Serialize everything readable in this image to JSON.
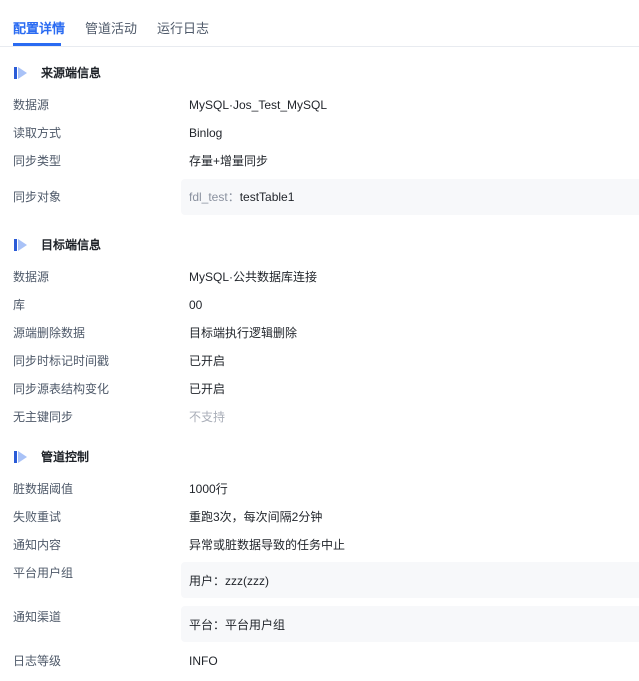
{
  "tabs": [
    {
      "label": "配置详情"
    },
    {
      "label": "管道活动"
    },
    {
      "label": "运行日志"
    }
  ],
  "colors": {
    "accent": "#2a6bf2",
    "icon_dark": "#2a5bd7",
    "icon_light": "#a9c2f7",
    "muted": "#a9aeb8",
    "box_bg": "#f7f8fa"
  },
  "source": {
    "title": "来源端信息",
    "rows": [
      {
        "label": "数据源",
        "value": "MySQL·Jos_Test_MySQL"
      },
      {
        "label": "读取方式",
        "value": "Binlog"
      },
      {
        "label": "同步类型",
        "value": "存量+增量同步"
      }
    ],
    "sync_object": {
      "label": "同步对象",
      "prefix": "fdl_test：",
      "value": "testTable1"
    }
  },
  "target": {
    "title": "目标端信息",
    "rows": [
      {
        "label": "数据源",
        "value": "MySQL·公共数据库连接"
      },
      {
        "label": "库",
        "value": "00"
      },
      {
        "label": "源端删除数据",
        "value": "目标端执行逻辑删除"
      },
      {
        "label": "同步时标记时间戳",
        "value": "已开启"
      },
      {
        "label": "同步源表结构变化",
        "value": "已开启"
      },
      {
        "label": "无主键同步",
        "value": "不支持"
      }
    ]
  },
  "control": {
    "title": "管道控制",
    "rows": [
      {
        "label": "脏数据阈值",
        "value": "1000行"
      },
      {
        "label": "失败重试",
        "value": "重跑3次，每次间隔2分钟"
      },
      {
        "label": "通知内容",
        "value": "异常或脏数据导致的任务中止"
      }
    ],
    "user_group": {
      "label": "平台用户组",
      "value": "用户：zzz(zzz)"
    },
    "channel": {
      "label": "通知渠道",
      "value": "平台：平台用户组"
    },
    "log_level": {
      "label": "日志等级",
      "value": "INFO"
    }
  },
  "icons": {
    "section": "section-marker-icon"
  }
}
